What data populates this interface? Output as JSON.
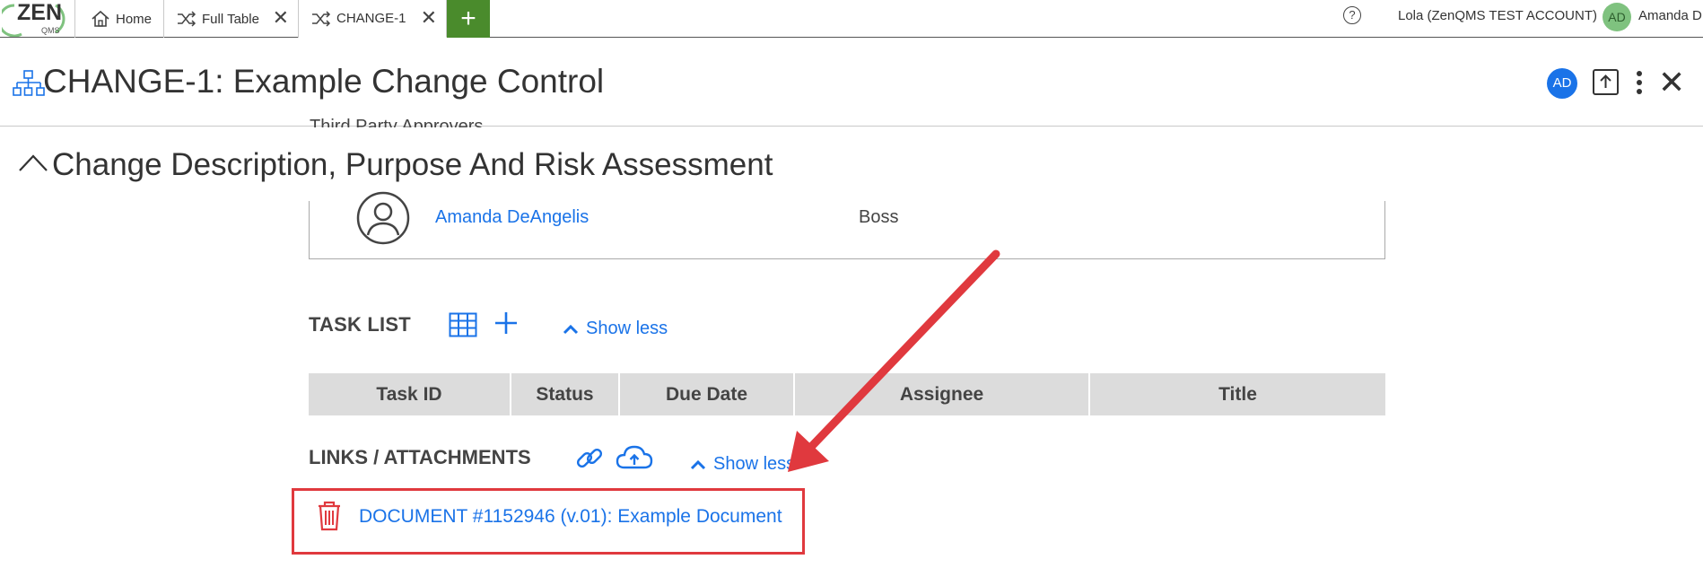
{
  "logo": {
    "text": "ZEN",
    "subtext": "QMS"
  },
  "tabs": [
    {
      "label": "Home"
    },
    {
      "label": "Full Table"
    },
    {
      "label": "CHANGE-1"
    }
  ],
  "topbar": {
    "help_symbol": "?",
    "account": "Lola (ZenQMS TEST ACCOUNT)",
    "user_initials": "AD",
    "user_name": "Amanda D"
  },
  "record": {
    "title": "CHANGE-1: Example Change Control",
    "avatar_initials": "AD",
    "peek_text": "Third Party Approvers"
  },
  "section": {
    "title": "Change Description, Purpose And Risk Assessment"
  },
  "approver": {
    "name": "Amanda DeAngelis",
    "role": "Boss"
  },
  "task_list": {
    "title": "TASK LIST",
    "show_less": "Show less",
    "columns": [
      "Task ID",
      "Status",
      "Due Date",
      "Assignee",
      "Title"
    ]
  },
  "links": {
    "title": "LINKS / ATTACHMENTS",
    "show_less": "Show less",
    "document": "DOCUMENT #1152946 (v.01): Example Document"
  },
  "colors": {
    "accent": "#1a73e8",
    "add_tab": "#4a8b2c",
    "annotation": "#e0393e"
  }
}
